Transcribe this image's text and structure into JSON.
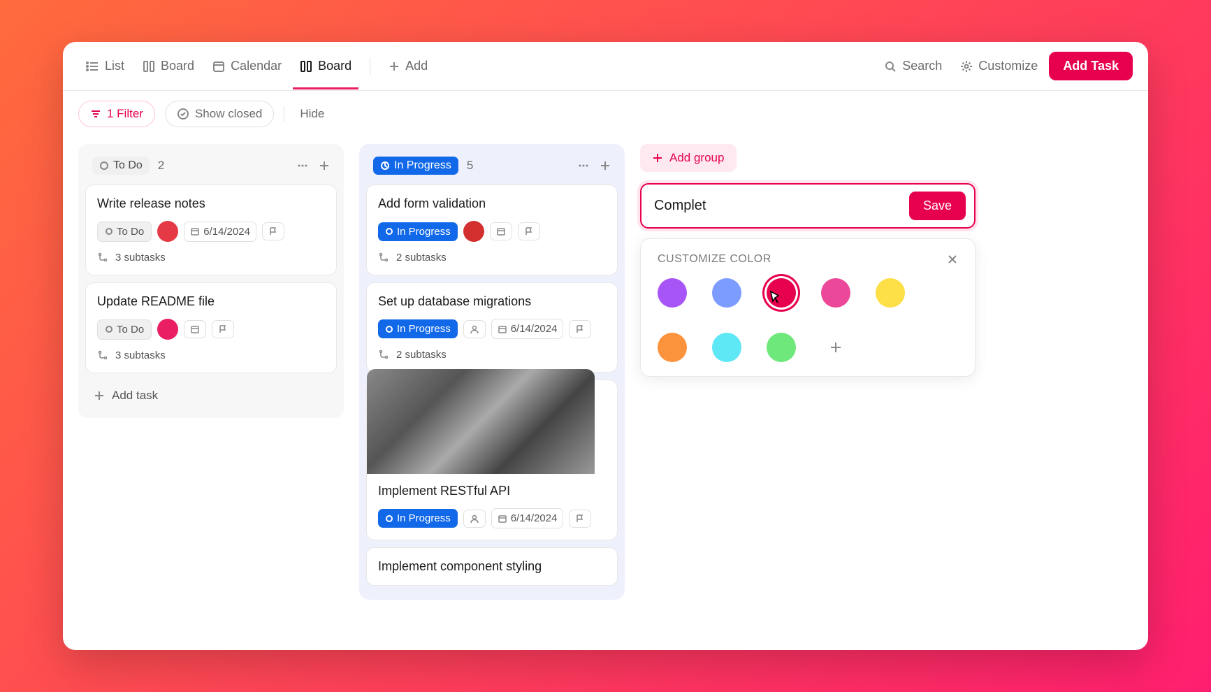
{
  "toolbar": {
    "views": [
      {
        "label": "List",
        "icon": "list"
      },
      {
        "label": "Board",
        "icon": "board"
      },
      {
        "label": "Calendar",
        "icon": "calendar"
      },
      {
        "label": "Board",
        "icon": "board",
        "active": true
      }
    ],
    "add_label": "Add",
    "search_label": "Search",
    "customize_label": "Customize",
    "add_task_label": "Add Task"
  },
  "filters": {
    "filter_label": "1 Filter",
    "show_closed_label": "Show closed",
    "hide_label": "Hide"
  },
  "columns": {
    "todo": {
      "label": "To Do",
      "count": "2",
      "cards": [
        {
          "title": "Write release notes",
          "status": "To Do",
          "date": "6/14/2024",
          "subtasks": "3 subtasks",
          "avatar": "#e63946"
        },
        {
          "title": "Update README file",
          "status": "To Do",
          "subtasks": "3 subtasks",
          "avatar": "#e91e63"
        }
      ],
      "add_task_label": "Add task"
    },
    "in_progress": {
      "label": "In Progress",
      "count": "5",
      "cards": [
        {
          "title": "Add form validation",
          "status": "In Progress",
          "subtasks": "2 subtasks",
          "avatar": "#d32f2f"
        },
        {
          "title": "Set up database migrations",
          "status": "In Progress",
          "date": "6/14/2024",
          "subtasks": "2 subtasks"
        },
        {
          "title": "Implement RESTful API",
          "status": "In Progress",
          "date": "6/14/2024",
          "has_image": true
        },
        {
          "title": "Implement component styling"
        }
      ]
    }
  },
  "add_group": {
    "button_label": "Add group",
    "input_value": "Complet",
    "save_label": "Save",
    "color_title": "CUSTOMIZE COLOR",
    "colors": [
      "#a855f7",
      "#7c9cff",
      "#e6004e",
      "#ec4899",
      "#fde047",
      "#fb923c",
      "#5ee7f5",
      "#6ee87a"
    ],
    "selected_color_index": 2
  }
}
